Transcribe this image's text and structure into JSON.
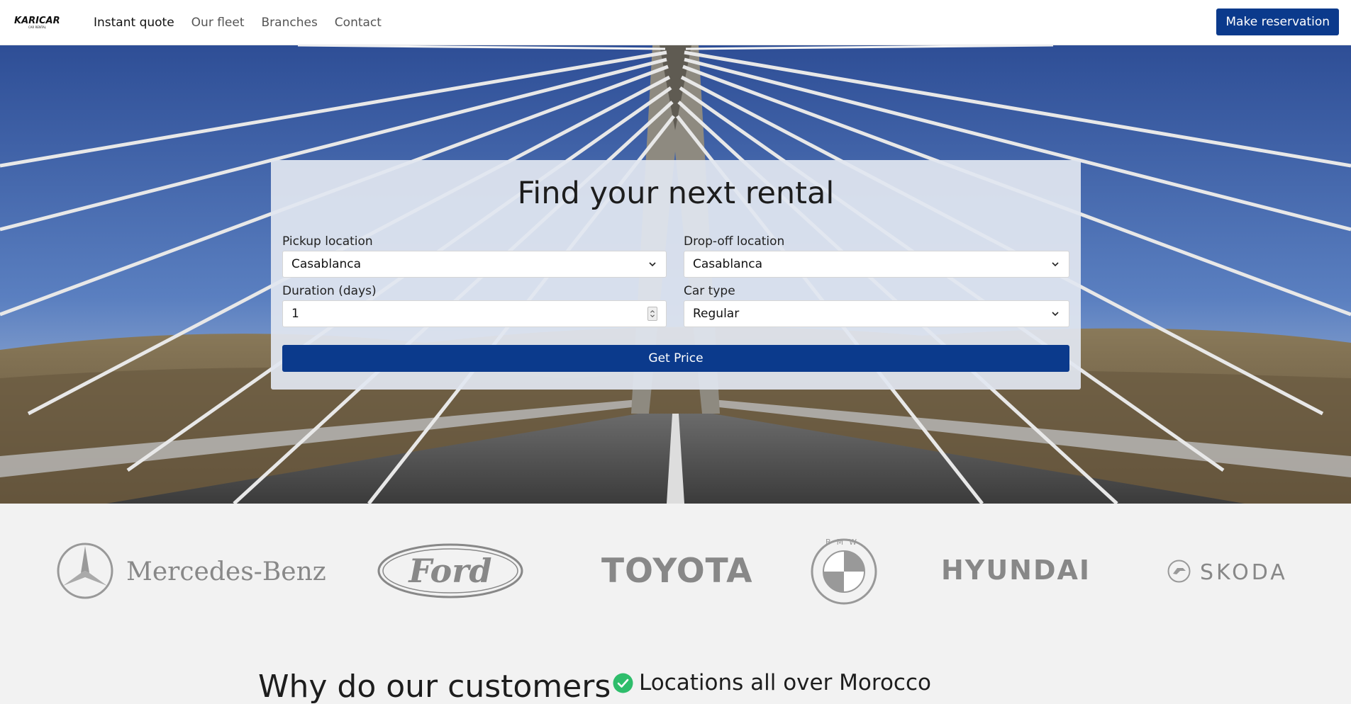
{
  "nav": {
    "logo_text": "KARICAR",
    "logo_subtext": "CAR RENTAL",
    "links": [
      "Instant quote",
      "Our fleet",
      "Branches",
      "Contact"
    ],
    "reserve_label": "Make reservation",
    "accent_color": "#0b3a8c"
  },
  "quote": {
    "title": "Find your next rental",
    "pickup_label": "Pickup location",
    "pickup_value": "Casablanca",
    "dropoff_label": "Drop-off location",
    "dropoff_value": "Casablanca",
    "duration_label": "Duration (days)",
    "duration_value": "1",
    "cartype_label": "Car type",
    "cartype_value": "Regular",
    "submit_label": "Get Price"
  },
  "brands": [
    "Mercedes-Benz",
    "Ford",
    "TOYOTA",
    "BMW",
    "HYUNDAI",
    "SKODA"
  ],
  "why": {
    "heading": "Why do our customers",
    "feature_1": "Locations all over Morocco",
    "check_color": "#2ebd6b"
  }
}
